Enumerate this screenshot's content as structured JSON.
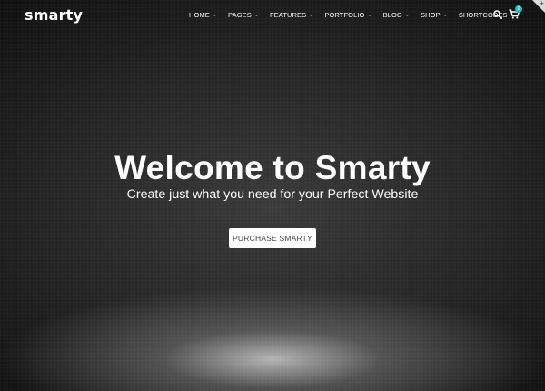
{
  "brand": {
    "logo_text": "smarty"
  },
  "nav": {
    "items": [
      {
        "label": "HOME",
        "has_dropdown": true
      },
      {
        "label": "PAGES",
        "has_dropdown": true
      },
      {
        "label": "FEATURES",
        "has_dropdown": true
      },
      {
        "label": "PORTFOLIO",
        "has_dropdown": true
      },
      {
        "label": "BLOG",
        "has_dropdown": true
      },
      {
        "label": "SHOP",
        "has_dropdown": true
      },
      {
        "label": "SHORTCODES",
        "has_dropdown": true
      }
    ],
    "search_icon": "search-icon",
    "cart_icon": "shopping-cart-icon",
    "cart_count": "0"
  },
  "hero": {
    "title": "Welcome to Smarty",
    "subtitle": "Create just what you need for your Perfect Website",
    "cta_label": "PURCHASE SMARTY"
  },
  "colors": {
    "background": "#0d0d0d",
    "text": "#ffffff",
    "accent": "#29b5c4",
    "button_bg": "#ffffff",
    "button_text": "#444444"
  }
}
